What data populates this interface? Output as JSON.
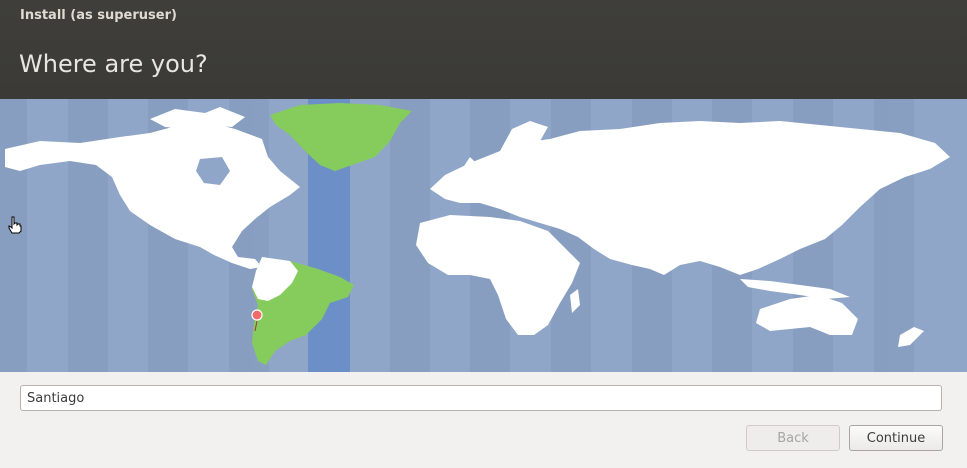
{
  "window": {
    "title": "Install (as superuser)"
  },
  "page": {
    "title": "Where are you?"
  },
  "map": {
    "selected_city": "Santiago",
    "colors": {
      "ocean": "#8fa6c8",
      "land": "#ffffff",
      "highlight_land": "#86cc5c",
      "highlight_band": "#6c8fc8",
      "marker": "#f06a6a"
    }
  },
  "location": {
    "value": "Santiago",
    "placeholder": ""
  },
  "buttons": {
    "back": "Back",
    "continue": "Continue"
  },
  "cursor": {
    "icon": "hand-pointer-icon"
  }
}
